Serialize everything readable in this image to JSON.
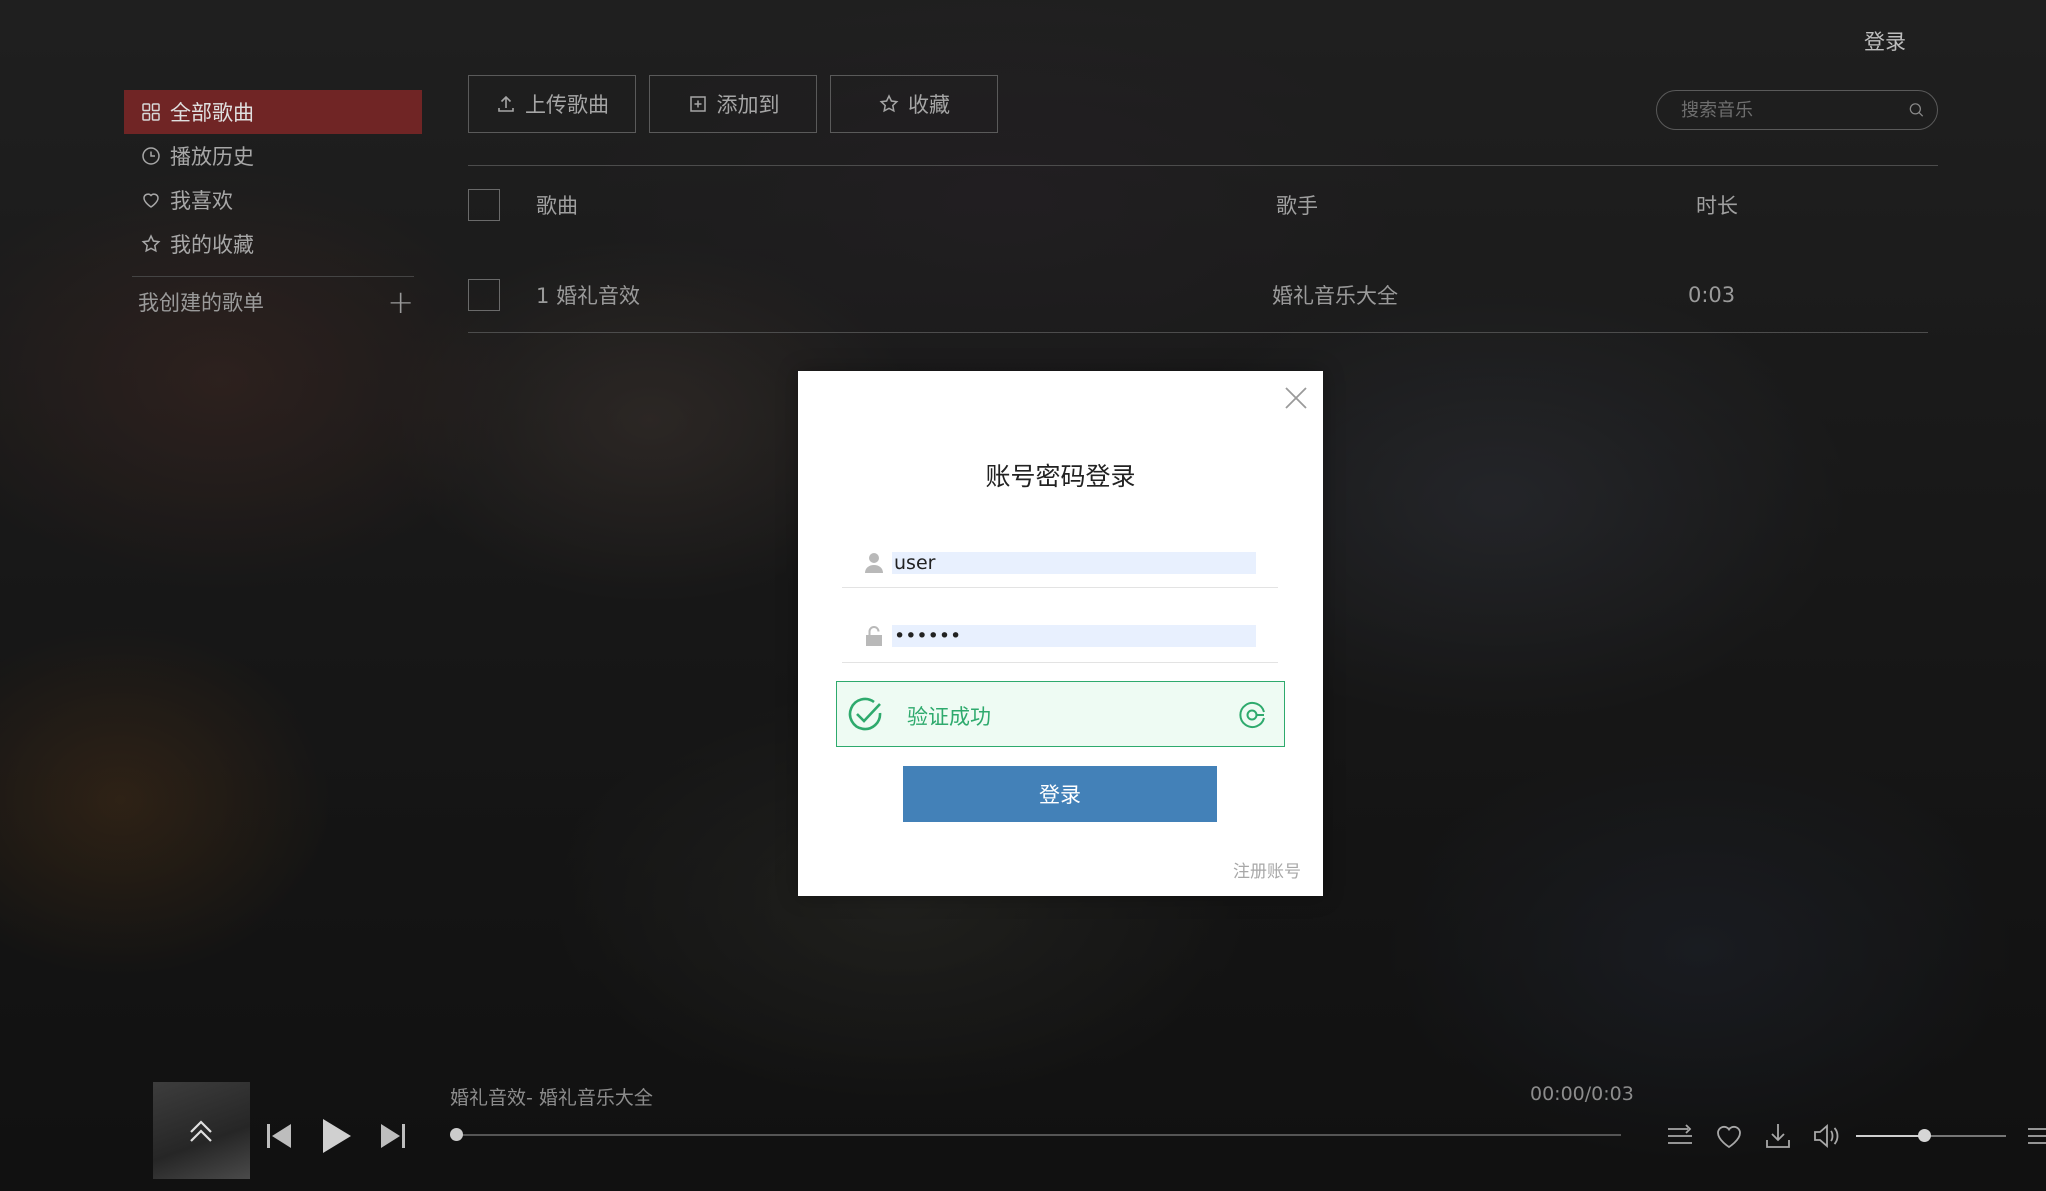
{
  "header": {
    "login_label": "登录"
  },
  "sidebar": {
    "items": [
      {
        "label": "全部歌曲",
        "icon": "grid-icon",
        "active": true
      },
      {
        "label": "播放历史",
        "icon": "clock-icon",
        "active": false
      },
      {
        "label": "我喜欢",
        "icon": "heart-icon",
        "active": false
      },
      {
        "label": "我的收藏",
        "icon": "star-icon",
        "active": false
      }
    ],
    "playlists_label": "我创建的歌单",
    "add_symbol": "+"
  },
  "toolbar": {
    "upload_label": "上传歌曲",
    "add_to_label": "添加到",
    "favorite_label": "收藏"
  },
  "search": {
    "placeholder": "搜索音乐"
  },
  "table": {
    "columns": [
      "歌曲",
      "歌手",
      "时长"
    ],
    "rows": [
      {
        "index": "1",
        "title": "婚礼音效",
        "artist": "婚礼音乐大全",
        "duration": "0:03"
      }
    ]
  },
  "player": {
    "now_playing": "婚礼音效- 婚礼音乐大全",
    "time": "00:00/0:03",
    "progress": 0.0,
    "volume": 0.45
  },
  "login_modal": {
    "title": "账号密码登录",
    "username": "user",
    "password": "••••••",
    "verify_text": "验证成功",
    "login_button": "登录",
    "register_link": "注册账号"
  },
  "colors": {
    "accent_red": "#8c2828",
    "login_blue": "#4381b8",
    "verify_green": "#2eaa6d"
  }
}
